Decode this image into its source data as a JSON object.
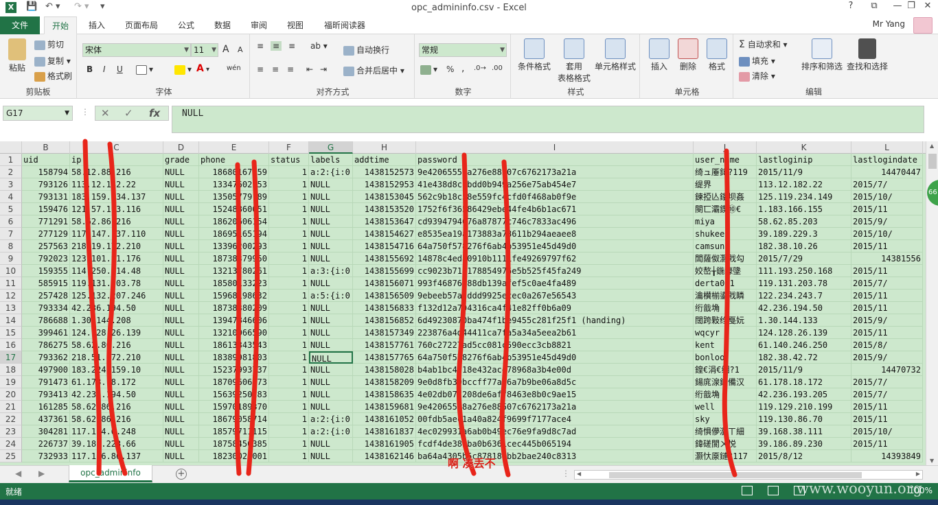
{
  "window": {
    "title": "opc_admininfo.csv - Excel",
    "buttons": [
      "?",
      "⧉",
      "—",
      "❐",
      "✕"
    ]
  },
  "ribbon_tabs": {
    "file": "文件",
    "tabs": [
      "开始",
      "插入",
      "页面布局",
      "公式",
      "数据",
      "审阅",
      "视图",
      "福昕阅读器"
    ],
    "active": "开始",
    "user": "Mr Yang"
  },
  "ribbon": {
    "clipboard": {
      "paste": "粘贴",
      "cut": "剪切",
      "copy": "复制",
      "format_painter": "格式刷",
      "label": "剪贴板"
    },
    "font": {
      "name": "宋体",
      "size": "11",
      "bold": "B",
      "italic": "I",
      "underline": "U",
      "label": "字体",
      "grow": "A",
      "shrink": "A",
      "phonetic": "wén"
    },
    "alignment": {
      "wrap_text": "自动换行",
      "merge_center": "合并后居中",
      "label": "对齐方式"
    },
    "number": {
      "format": "常规",
      "percent": "%",
      "comma": ",",
      "label": "数字"
    },
    "styles": {
      "conditional": "条件格式",
      "table_line1": "套用",
      "table_line2": "表格格式",
      "cell_styles": "单元格样式",
      "label": "样式"
    },
    "cells": {
      "insert": "插入",
      "delete": "删除",
      "format": "格式",
      "label": "单元格"
    },
    "editing": {
      "autosum": "自动求和",
      "fill": "填充",
      "clear": "清除",
      "sort_filter": "排序和筛选",
      "find_select": "查找和选择",
      "label": "编辑"
    }
  },
  "formula_bar": {
    "name_box": "G17",
    "fx": "fx",
    "content": "NULL"
  },
  "columns": [
    {
      "letter": "B",
      "header": "uid",
      "align": "r"
    },
    {
      "letter": "C",
      "header": "ip",
      "align": "l"
    },
    {
      "letter": "D",
      "header": "grade",
      "align": "l"
    },
    {
      "letter": "E",
      "header": "phone",
      "align": "r"
    },
    {
      "letter": "F",
      "header": "status",
      "align": "r"
    },
    {
      "letter": "G",
      "header": "labels",
      "align": "l"
    },
    {
      "letter": "H",
      "header": "addtime",
      "align": "r"
    },
    {
      "letter": "I",
      "header": "password",
      "align": "l"
    },
    {
      "letter": "J",
      "header": "user_name",
      "align": "l"
    },
    {
      "letter": "K",
      "header": "lastloginip",
      "align": "l"
    },
    {
      "letter": "L",
      "header": "lastlogindate",
      "align": "r"
    }
  ],
  "rows": [
    [
      "158794",
      "58.12.88.216",
      "NULL",
      "18680167759",
      "1",
      "a:2:{i:0",
      "1438152573",
      "9e42065558a276e88507c6762173a21a",
      "绮ュ厜鍏?119",
      "2015/11/9",
      "14470447"
    ],
    [
      "793126",
      "113.12.182.22",
      "NULL",
      "13347602253",
      "1",
      "NULL",
      "1438152953",
      "41e438d8cfbdd0b949a256e75ab454e7",
      "缇界",
      "113.12.182.22",
      "2015/7/"
    ],
    [
      "793131",
      "183.159.234.137",
      "NULL",
      "13505779189",
      "1",
      "NULL",
      "1438153045",
      "562c9b18c58e559fc4cfd0f468ab0f9e",
      "鍊掗亾鏤坝姦",
      "125.119.234.149",
      "2015/10/"
    ],
    [
      "159476",
      "121.57.193.116",
      "NULL",
      "15248860051",
      "1",
      "NULL",
      "1438153520",
      "1752f6f36586429ebe44fe4b6b1ac671",
      "閿匸灞鍥⑩€",
      "1.183.166.155",
      "2015/11"
    ],
    [
      "771291",
      "58.62.86.216",
      "NULL",
      "18620606154",
      "1",
      "NULL",
      "1438153647",
      "cd9394794676a87877c746c7833ac496",
      "miya",
      "58.62.85.203",
      "2015/9/"
    ],
    [
      "277129",
      "117.147.137.110",
      "NULL",
      "18695165194",
      "1",
      "NULL",
      "1438154627",
      "e8535ea19a173883a78611b294aeaee8",
      "shukee",
      "39.189.229.3",
      "2015/10/"
    ],
    [
      "257563",
      "218.19.172.210",
      "NULL",
      "13396200293",
      "1",
      "NULL",
      "1438154716",
      "64a750f578276f6ab4b53951e45d49d0",
      "camsun",
      "182.38.10.26",
      "2015/11"
    ],
    [
      "792023",
      "123.101.81.176",
      "NULL",
      "18738379950",
      "1",
      "NULL",
      "1438155692",
      "14878c4eda0910b1111fe49269797f62",
      "闆薩伮灏戝勾",
      "2015/7/29",
      "14381556"
    ],
    [
      "159355",
      "114.250.214.48",
      "NULL",
      "13213780261",
      "1",
      "a:3:{i:0",
      "1438155699",
      "cc9023b71e178854976e5b525f45fa249",
      "姣嶅╁鍦壕墬",
      "111.193.250.168",
      "2015/11"
    ],
    [
      "585915",
      "119.131.203.78",
      "NULL",
      "18580133223",
      "1",
      "NULL",
      "1438156071",
      "993f46876b88db139afef5c0ae4fa489",
      "derta001",
      "119.131.203.78",
      "2015/7/"
    ],
    [
      "257428",
      "125.132.207.246",
      "NULL",
      "15968198632",
      "1",
      "a:5:{i:0",
      "1438156509",
      "9ebeeb57adddd9925ecec0a267e56543",
      "瀹櫕椾鍙戝瞵",
      "122.234.243.7",
      "2015/11"
    ],
    [
      "793334",
      "42.236.194.50",
      "NULL",
      "18738380209",
      "1",
      "NULL",
      "1438156833",
      "f132d12a794316ca4f41e82ff0b6a09",
      "绗戠埆",
      "42.236.194.50",
      "2015/11"
    ],
    [
      "786688",
      "1.30.144.208",
      "NULL",
      "13947846606",
      "1",
      "NULL",
      "1438156852",
      "6d49230870ba474f1be9455c281f25f1 (handing)",
      "闊跨敤绉戞妧",
      "1.30.144.133",
      "2015/9/"
    ],
    [
      "399461",
      "124.128.26.139",
      "NULL",
      "13210066590",
      "1",
      "NULL",
      "1438157349",
      "223876a4d44411ca7fa5a34a5eea2b61",
      "wqcyr",
      "124.128.26.139",
      "2015/11"
    ],
    [
      "786275",
      "58.62.86.216",
      "NULL",
      "18613343543",
      "1",
      "NULL",
      "1438157761",
      "760c27227ad5cc081c590ecc3cb8821",
      "kent",
      "61.140.246.250",
      "2015/8/"
    ],
    [
      "793362",
      "218.51.172.210",
      "NULL",
      "18389981803",
      "1",
      "NULL",
      "1438157765",
      "64a750f578276f6ab4b53951e45d49d0",
      "bonloo",
      "182.38.42.72",
      "2015/9/"
    ],
    [
      "497900",
      "183.224.159.10",
      "NULL",
      "15237993737",
      "1",
      "NULL",
      "1438158028",
      "b4ab1bc4d18e432ace78968a3b4e00d",
      "鍠€涓€缃?1",
      "2015/11/9",
      "14470732"
    ],
    [
      "791473",
      "61.178.18.172",
      "NULL",
      "18709606173",
      "1",
      "NULL",
      "1438158209",
      "9e0d8fb39bccff77ab6a7b9be06a8d5c",
      "鍚庣湶鐙備汉",
      "61.178.18.172",
      "2015/7/"
    ],
    [
      "793413",
      "42.236.194.50",
      "NULL",
      "15639250283",
      "1",
      "NULL",
      "1438158635",
      "4e02db07f208de6aff8463e8b0c9ae15",
      "绗戠埆",
      "42.236.193.205",
      "2015/7/"
    ],
    [
      "161285",
      "58.62.86.216",
      "NULL",
      "15970189370",
      "1",
      "NULL",
      "1438159681",
      "9e42065558a276e88507c6762173a21a",
      "well",
      "119.129.210.199",
      "2015/11"
    ],
    [
      "437361",
      "58.62.86.216",
      "NULL",
      "18679058714",
      "1",
      "a:2:{i:0",
      "1438161052",
      "00fdb5aec1a40a824f9699f7177ace4",
      "sky",
      "119.130.86.70",
      "2015/11"
    ],
    [
      "304281",
      "117.134.6.248",
      "NULL",
      "18579711115",
      "1",
      "a:2:{i:0",
      "1438161837",
      "4ec029931a6ab0b49ec76e9fa9d8c7ad",
      "绮惧儚瀵ㄒ細",
      "39.168.38.111",
      "2015/10/"
    ],
    [
      "226737",
      "39.186.223.66",
      "NULL",
      "18758456385",
      "1",
      "NULL",
      "1438161905",
      "fcdf4de387ba0b6361cec445b065194",
      "鍏磋閬ㄨ悦",
      "39.186.89.230",
      "2015/11"
    ],
    [
      "732933",
      "117.136.86.137",
      "NULL",
      "18230021001",
      "1",
      "NULL",
      "1438162146",
      "ba64a4305b5c878182bb2bae240c8313",
      "灏忕厡鏈?117",
      "2015/8/12",
      "14393849"
    ]
  ],
  "active_cell": {
    "row": 17,
    "col": "G"
  },
  "sheet_tabs": {
    "name": "opc_admininfo",
    "add": "+"
  },
  "statusbar": {
    "ready": "就绪",
    "zoom": "100%",
    "watermark": "www.wooyun.org"
  },
  "side_badge": "66",
  "annotation": "啊  凑丢不"
}
